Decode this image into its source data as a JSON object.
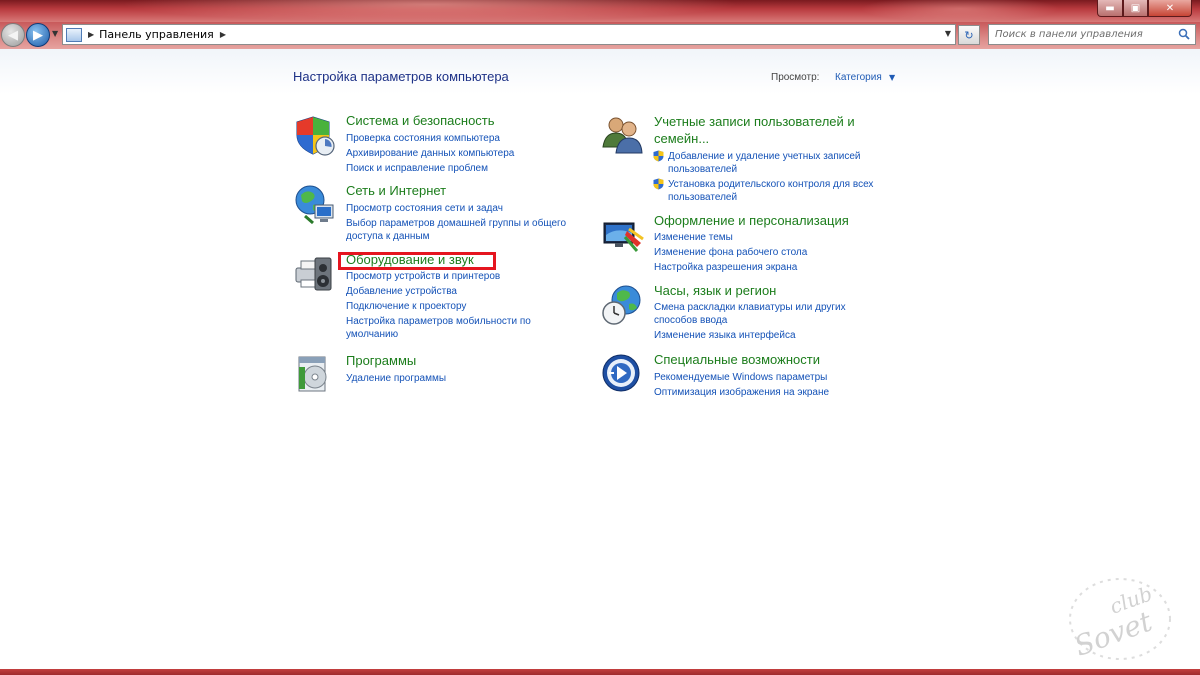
{
  "window": {
    "controls": {
      "minimize": "▬",
      "maximize": "▣",
      "close": "✕"
    }
  },
  "nav": {
    "back_icon": "arrow-left-icon",
    "forward_icon": "arrow-right-icon",
    "address": {
      "crumb": "Панель управления",
      "separator": "▶"
    },
    "refresh_icon": "refresh-icon",
    "search": {
      "placeholder": "Поиск в панели управления"
    }
  },
  "header": {
    "title": "Настройка параметров компьютера",
    "view_label": "Просмотр:",
    "view_value": "Категория"
  },
  "categories_left": [
    {
      "heading": "Система и безопасность",
      "icon": "shield-icon",
      "links": [
        "Проверка состояния компьютера",
        "Архивирование данных компьютера",
        "Поиск и исправление проблем"
      ]
    },
    {
      "heading": "Сеть и Интернет",
      "icon": "network-globe-icon",
      "links": [
        "Просмотр состояния сети и задач",
        "Выбор параметров домашней группы и общего доступа к данным"
      ]
    },
    {
      "heading": "Оборудование и звук",
      "icon": "printer-icon",
      "links": [
        "Просмотр устройств и принтеров",
        "Добавление устройства",
        "Подключение к проектору",
        "Настройка параметров мобильности по умолчанию"
      ]
    },
    {
      "heading": "Программы",
      "icon": "programs-icon",
      "links": [
        "Удаление программы"
      ]
    }
  ],
  "categories_right": [
    {
      "heading": "Учетные записи пользователей и семейн...",
      "icon": "users-icon",
      "links": [
        "Добавление и удаление учетных записей пользователей",
        "Установка родительского контроля для всех пользователей"
      ]
    },
    {
      "heading": "Оформление и персонализация",
      "icon": "personalization-icon",
      "links": [
        "Изменение темы",
        "Изменение фона рабочего стола",
        "Настройка разрешения экрана"
      ]
    },
    {
      "heading": "Часы, язык и регион",
      "icon": "clock-globe-icon",
      "links": [
        "Смена раскладки клавиатуры или других способов ввода",
        "Изменение языка интерфейса"
      ]
    },
    {
      "heading": "Специальные возможности",
      "icon": "accessibility-icon",
      "links": [
        "Рекомендуемые Windows параметры",
        "Оптимизация изображения на экране"
      ]
    }
  ],
  "watermark": {
    "line1": "club",
    "line2": "Sovet"
  }
}
